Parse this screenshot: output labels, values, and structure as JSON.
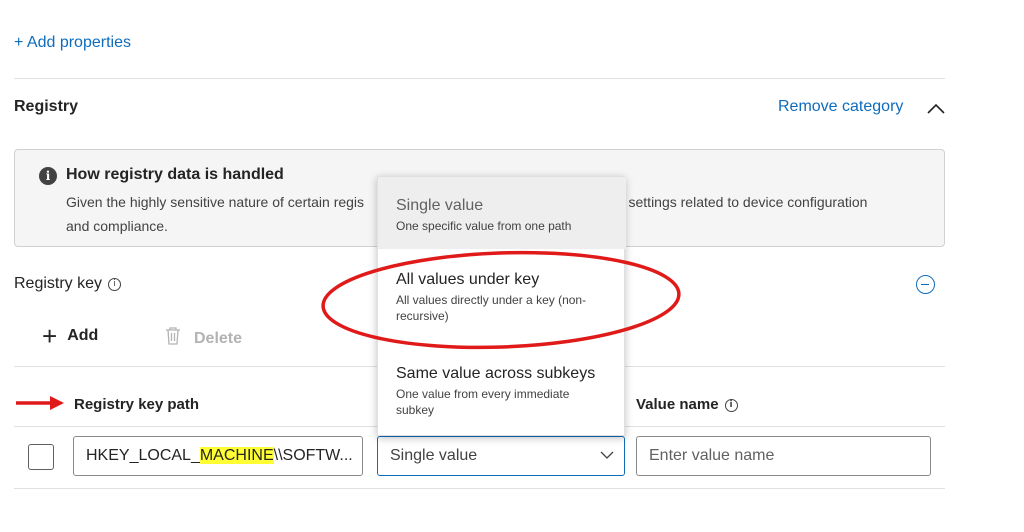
{
  "add_properties": "+ Add properties",
  "category": {
    "title": "Registry",
    "remove_label": "Remove category"
  },
  "info": {
    "title": "How registry data is handled",
    "body_start": "Given the highly sensitive nature of certain regis",
    "body_end": "ng settings related to device configuration",
    "body_line2": "and compliance."
  },
  "registry_key": {
    "label": "Registry key",
    "add_label": "Add",
    "delete_label": "Delete"
  },
  "table": {
    "col_path": "Registry key path",
    "col_value_name": "Value name",
    "row": {
      "path_prefix": "HKEY_LOCAL_",
      "path_highlight": "MACHINE",
      "path_suffix": "\\\\SOFTW...",
      "select_value": "Single value",
      "value_placeholder": "Enter value name"
    }
  },
  "dropdown": {
    "options": [
      {
        "title": "Single value",
        "desc": "One specific value from one path"
      },
      {
        "title": "All values under key",
        "desc": "All values directly under a key (non-recursive)"
      },
      {
        "title": "Same value across subkeys",
        "desc": "One value from every immediate subkey"
      }
    ]
  },
  "colors": {
    "link": "#0f6cbd",
    "highlight": "#ffff33",
    "annotation_red": "#e01919"
  }
}
